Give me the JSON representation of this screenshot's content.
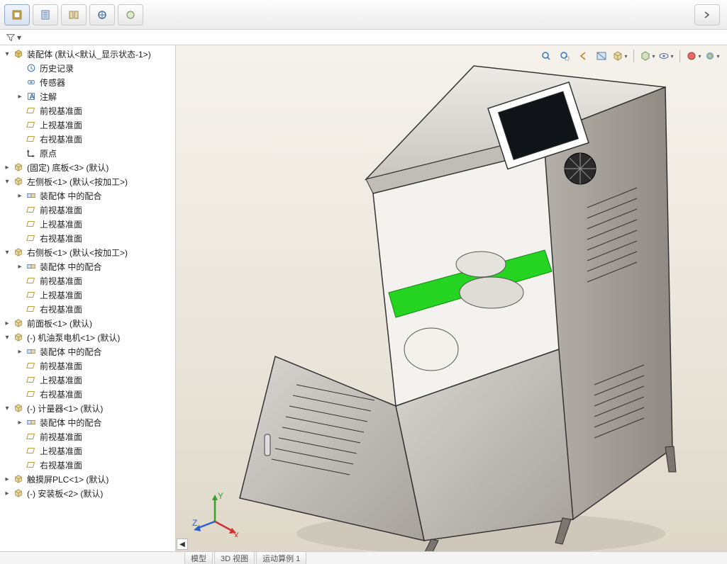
{
  "panelTabs": [
    "feature-manager",
    "property-manager",
    "configuration-manager",
    "dimxpert",
    "display-overflow"
  ],
  "viewToolbar": [
    "zoom-fit",
    "zoom-area",
    "previous-view",
    "section-view",
    "view-orientation",
    "display-style",
    "hide-show",
    "edit-appearance",
    "apply-scene"
  ],
  "footerTabs": [
    "模型",
    "3D 视图",
    "运动算例 1"
  ],
  "tree": [
    {
      "d": 0,
      "e": "open",
      "ic": "assembly",
      "t": "装配体  (默认<默认_显示状态-1>)"
    },
    {
      "d": 1,
      "e": "",
      "ic": "history",
      "t": "历史记录"
    },
    {
      "d": 1,
      "e": "",
      "ic": "sensor",
      "t": "传感器"
    },
    {
      "d": 1,
      "e": "closed",
      "ic": "annotation",
      "t": "注解"
    },
    {
      "d": 1,
      "e": "",
      "ic": "plane",
      "t": "前视基准面"
    },
    {
      "d": 1,
      "e": "",
      "ic": "plane",
      "t": "上视基准面"
    },
    {
      "d": 1,
      "e": "",
      "ic": "plane",
      "t": "右视基准面"
    },
    {
      "d": 1,
      "e": "",
      "ic": "origin",
      "t": "原点"
    },
    {
      "d": 0,
      "e": "closed",
      "ic": "part",
      "t": "(固定) 底板<3> (默认)"
    },
    {
      "d": 0,
      "e": "open",
      "ic": "part",
      "t": "左侧板<1> (默认<按加工>)"
    },
    {
      "d": 1,
      "e": "closed",
      "ic": "mates",
      "t": "装配体 中的配合"
    },
    {
      "d": 1,
      "e": "",
      "ic": "plane",
      "t": "前视基准面"
    },
    {
      "d": 1,
      "e": "",
      "ic": "plane",
      "t": "上视基准面"
    },
    {
      "d": 1,
      "e": "",
      "ic": "plane",
      "t": "右视基准面"
    },
    {
      "d": 0,
      "e": "open",
      "ic": "part",
      "t": "右侧板<1> (默认<按加工>)"
    },
    {
      "d": 1,
      "e": "closed",
      "ic": "mates",
      "t": "装配体 中的配合"
    },
    {
      "d": 1,
      "e": "",
      "ic": "plane",
      "t": "前视基准面"
    },
    {
      "d": 1,
      "e": "",
      "ic": "plane",
      "t": "上视基准面"
    },
    {
      "d": 1,
      "e": "",
      "ic": "plane",
      "t": "右视基准面"
    },
    {
      "d": 0,
      "e": "closed",
      "ic": "part",
      "t": "前面板<1> (默认)"
    },
    {
      "d": 0,
      "e": "open",
      "ic": "part",
      "t": "(-) 机油泵电机<1> (默认)"
    },
    {
      "d": 1,
      "e": "closed",
      "ic": "mates",
      "t": "装配体 中的配合"
    },
    {
      "d": 1,
      "e": "",
      "ic": "plane",
      "t": "前视基准面"
    },
    {
      "d": 1,
      "e": "",
      "ic": "plane",
      "t": "上视基准面"
    },
    {
      "d": 1,
      "e": "",
      "ic": "plane",
      "t": "右视基准面"
    },
    {
      "d": 0,
      "e": "open",
      "ic": "part",
      "t": "(-) 计量器<1> (默认)"
    },
    {
      "d": 1,
      "e": "closed",
      "ic": "mates",
      "t": "装配体 中的配合"
    },
    {
      "d": 1,
      "e": "",
      "ic": "plane",
      "t": "前视基准面"
    },
    {
      "d": 1,
      "e": "",
      "ic": "plane",
      "t": "上视基准面"
    },
    {
      "d": 1,
      "e": "",
      "ic": "plane",
      "t": "右视基准面"
    },
    {
      "d": 0,
      "e": "closed",
      "ic": "part",
      "t": "触摸屏PLC<1> (默认)"
    },
    {
      "d": 0,
      "e": "closed",
      "ic": "part",
      "t": "(-) 安装板<2> (默认)"
    }
  ]
}
